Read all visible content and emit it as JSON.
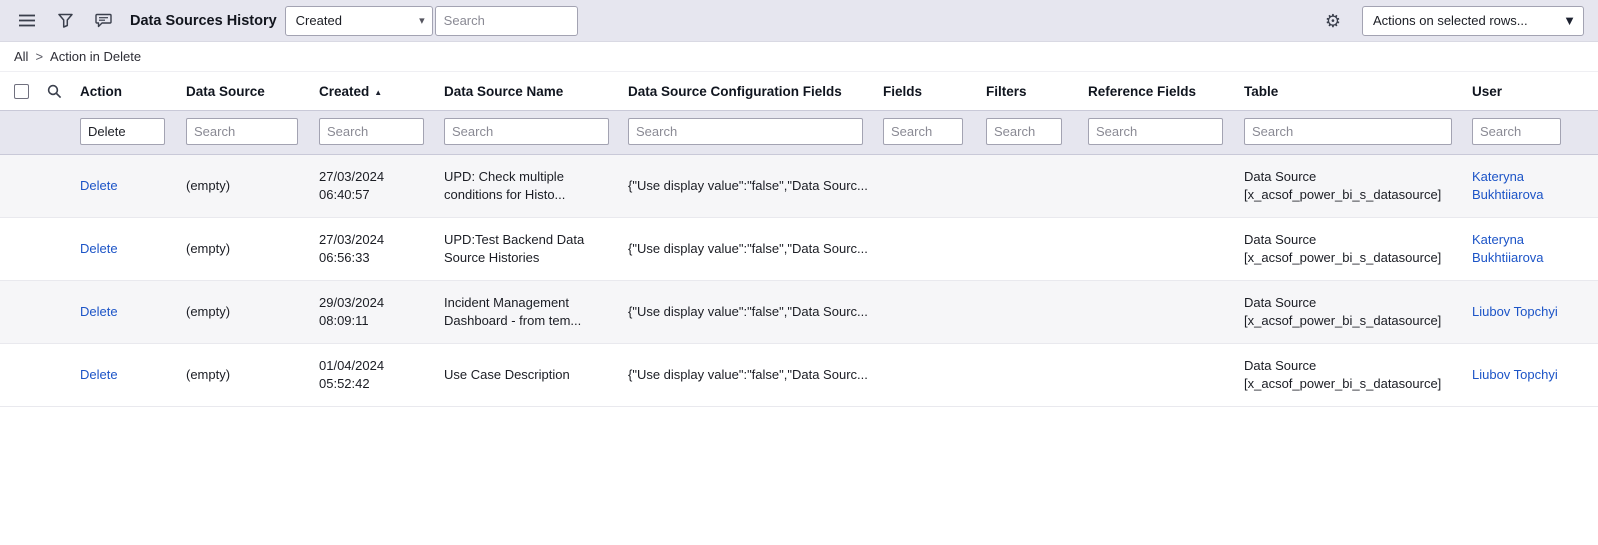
{
  "header": {
    "title": "Data Sources History",
    "filter_field_value": "Created",
    "search_placeholder": "Search",
    "actions_label": "Actions on selected rows..."
  },
  "breadcrumb": {
    "all": "All",
    "separator": ">",
    "current": "Action in Delete"
  },
  "icons": {
    "menu": "hamburger-menu",
    "filter": "funnel",
    "chat": "speech-bubble",
    "search": "magnifier",
    "gear": "⚙",
    "caret_down": "▾",
    "caret_down_bold": "▼",
    "sort_asc": "▲"
  },
  "table": {
    "columns": [
      "Action",
      "Data Source",
      "Created",
      "Data Source Name",
      "Data Source Configuration Fields",
      "Fields",
      "Filters",
      "Reference Fields",
      "Table",
      "User"
    ],
    "sorted_column": "Created",
    "sort_direction": "ascending",
    "filter_row": {
      "action_value": "Delete",
      "search_placeholder": "Search"
    },
    "rows": [
      {
        "action": "Delete",
        "data_source": "(empty)",
        "created": "27/03/2024 06:40:57",
        "data_source_name": "UPD: Check multiple conditions for Histo...",
        "config_fields": "{\"Use display value\":\"false\",\"Data Sourc...",
        "fields": "",
        "filters": "",
        "reference_fields": "",
        "table": "Data Source [x_acsof_power_bi_s_datasource]",
        "user": "Kateryna Bukhtiiarova"
      },
      {
        "action": "Delete",
        "data_source": "(empty)",
        "created": "27/03/2024 06:56:33",
        "data_source_name": "UPD:Test Backend Data Source Histories",
        "config_fields": "{\"Use display value\":\"false\",\"Data Sourc...",
        "fields": "",
        "filters": "",
        "reference_fields": "",
        "table": "Data Source [x_acsof_power_bi_s_datasource]",
        "user": "Kateryna Bukhtiiarova"
      },
      {
        "action": "Delete",
        "data_source": "(empty)",
        "created": "29/03/2024 08:09:11",
        "data_source_name": "Incident Management Dashboard - from tem...",
        "config_fields": "{\"Use display value\":\"false\",\"Data Sourc...",
        "fields": "",
        "filters": "",
        "reference_fields": "",
        "table": "Data Source [x_acsof_power_bi_s_datasource]",
        "user": "Liubov Topchyi"
      },
      {
        "action": "Delete",
        "data_source": "(empty)",
        "created": "01/04/2024 05:52:42",
        "data_source_name": "Use Case Description",
        "config_fields": "{\"Use display value\":\"false\",\"Data Sourc...",
        "fields": "",
        "filters": "",
        "reference_fields": "",
        "table": "Data Source [x_acsof_power_bi_s_datasource]",
        "user": "Liubov Topchyi"
      }
    ]
  }
}
